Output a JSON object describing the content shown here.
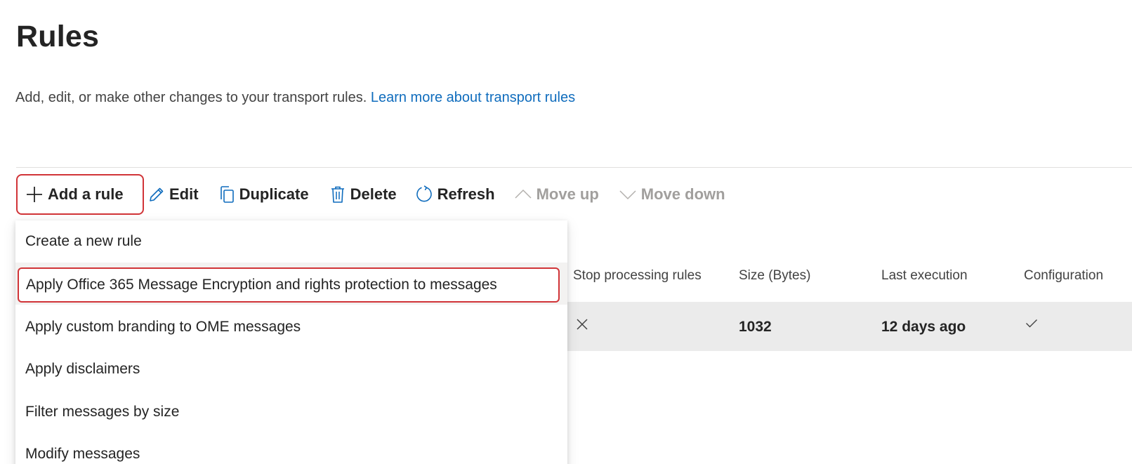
{
  "page": {
    "title": "Rules",
    "description": "Add, edit, or make other changes to your transport rules.",
    "learn_more": "Learn more about transport rules"
  },
  "toolbar": {
    "add_rule": "Add a rule",
    "edit": "Edit",
    "duplicate": "Duplicate",
    "delete": "Delete",
    "refresh": "Refresh",
    "move_up": "Move up",
    "move_down": "Move down"
  },
  "dropdown": {
    "items": [
      "Create a new rule",
      "Apply Office 365 Message Encryption and rights protection to messages",
      "Apply custom branding to OME messages",
      "Apply disclaimers",
      "Filter messages by size",
      "Modify messages"
    ]
  },
  "table": {
    "columns": [
      "Stop processing rules",
      "Size (Bytes)",
      "Last execution",
      "Configuration"
    ],
    "rows": [
      {
        "stop_processing": false,
        "size": "1032",
        "last_execution": "12 days ago",
        "configuration": true
      }
    ]
  },
  "colors": {
    "accent_link": "#0f6cbd",
    "highlight_border": "#d13438",
    "selected_row": "#ebebeb",
    "disabled_text": "#a19f9d"
  },
  "icons": [
    "add-icon",
    "edit-icon",
    "duplicate-icon",
    "delete-icon",
    "refresh-icon",
    "chevron-up-icon",
    "chevron-down-icon",
    "dismiss-icon",
    "checkmark-icon"
  ]
}
